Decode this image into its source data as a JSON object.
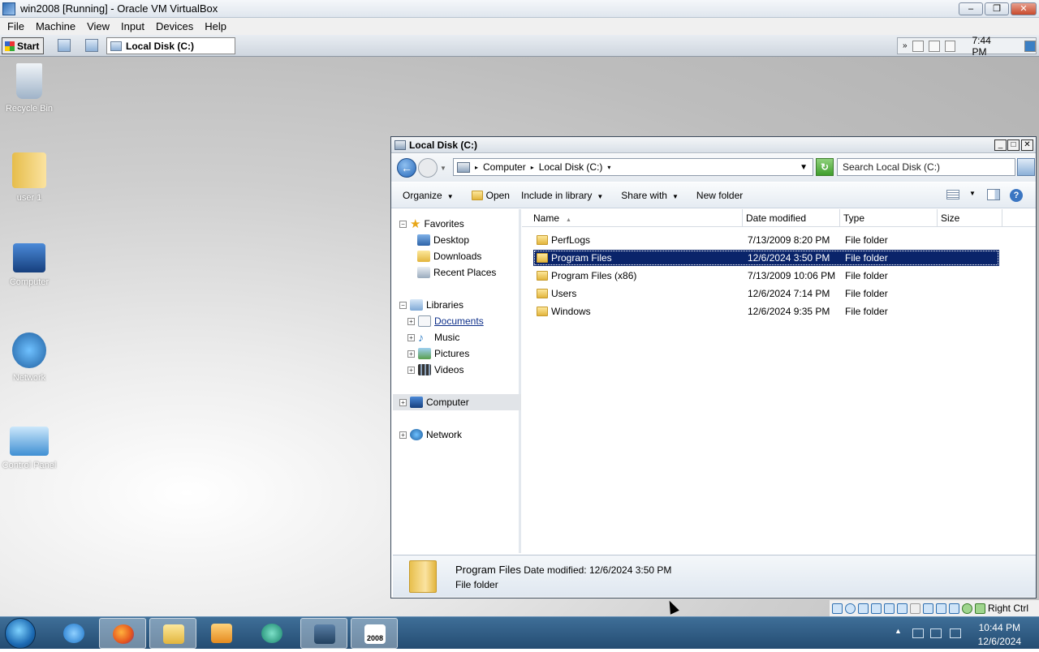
{
  "host": {
    "title": "win2008 [Running] - Oracle VM VirtualBox",
    "menu": [
      "File",
      "Machine",
      "View",
      "Input",
      "Devices",
      "Help"
    ],
    "right_ctrl": "Right Ctrl"
  },
  "vm_bar": {
    "start": "Start",
    "task": "Local Disk (C:)",
    "time": "7:44 PM"
  },
  "desktop_icons": [
    "Recycle Bin",
    "user 1",
    "Computer",
    "Network",
    "Control Panel"
  ],
  "window": {
    "title": "Local Disk (C:)",
    "breadcrumb": [
      "Computer",
      "Local Disk (C:)"
    ],
    "search_placeholder": "Search Local Disk (C:)",
    "commands": [
      "Organize",
      "Open",
      "Include in library",
      "Share with",
      "New folder"
    ],
    "nav": {
      "favorites": "Favorites",
      "favorites_items": [
        "Desktop",
        "Downloads",
        "Recent Places"
      ],
      "libraries": "Libraries",
      "libraries_items": [
        "Documents",
        "Music",
        "Pictures",
        "Videos"
      ],
      "computer": "Computer",
      "network": "Network"
    },
    "columns": [
      "Name",
      "Date modified",
      "Type",
      "Size"
    ],
    "files": [
      {
        "name": "PerfLogs",
        "date": "7/13/2009 8:20 PM",
        "type": "File folder",
        "size": ""
      },
      {
        "name": "Program Files",
        "date": "12/6/2024 3:50 PM",
        "type": "File folder",
        "size": ""
      },
      {
        "name": "Program Files (x86)",
        "date": "7/13/2009 10:06 PM",
        "type": "File folder",
        "size": ""
      },
      {
        "name": "Users",
        "date": "12/6/2024 7:14 PM",
        "type": "File folder",
        "size": ""
      },
      {
        "name": "Windows",
        "date": "12/6/2024 9:35 PM",
        "type": "File folder",
        "size": ""
      }
    ],
    "details": {
      "name": "Program Files",
      "date_label": "Date modified:",
      "date_value": "12/6/2024 3:50 PM",
      "type": "File folder"
    }
  },
  "taskbar": {
    "time": "10:44 PM",
    "date": "12/6/2024",
    "vm_label": "2008"
  }
}
